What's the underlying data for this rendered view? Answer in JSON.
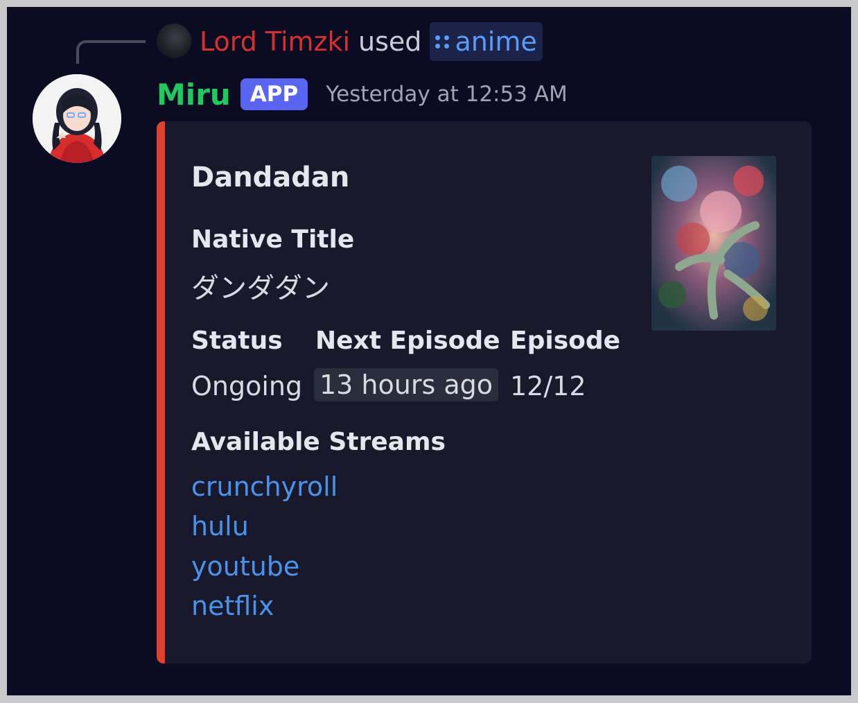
{
  "interaction": {
    "user": "Lord Timzki",
    "verb": "used",
    "command": "anime"
  },
  "message": {
    "author": "Miru",
    "badge": "APP",
    "timestamp": "Yesterday at 12:53 AM"
  },
  "embed": {
    "accent_color": "#e0412f",
    "title": "Dandadan",
    "fields": {
      "native_title": {
        "name": "Native Title",
        "value": "ダンダダン"
      },
      "status": {
        "name": "Status",
        "value": "Ongoing"
      },
      "next_episode": {
        "name": "Next Episode",
        "value": "13 hours ago"
      },
      "episode": {
        "name": "Episode",
        "value": "12/12"
      },
      "streams": {
        "name": "Available Streams",
        "links": [
          "crunchyroll",
          "hulu",
          "youtube",
          "netflix"
        ]
      }
    }
  },
  "colors": {
    "background": "#0b0c22",
    "author": "#1ec960",
    "invoker": "#d6312f",
    "link": "#4a93ec",
    "badge": "#5865f2"
  },
  "icons": {
    "command": "slash-command-icon"
  }
}
